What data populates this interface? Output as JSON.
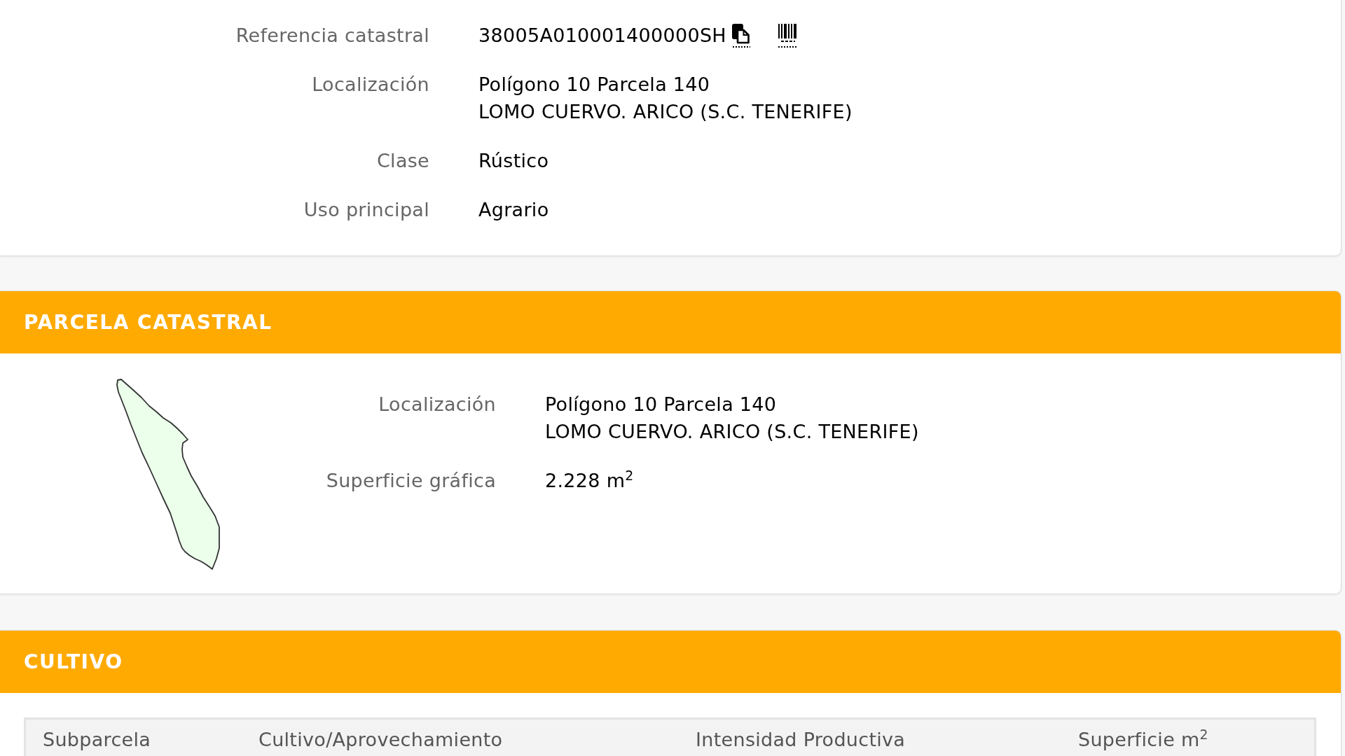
{
  "property_card": {
    "rows": [
      {
        "kind": "reference",
        "label": "Referencia catastral",
        "lines": [
          "38005A010001400000SH"
        ]
      },
      {
        "kind": "text",
        "label": "Localización",
        "lines": [
          "Polígono 10 Parcela 140",
          "LOMO CUERVO. ARICO (S.C. TENERIFE)"
        ]
      },
      {
        "kind": "text",
        "label": "Clase",
        "lines": [
          "Rústico"
        ]
      },
      {
        "kind": "text",
        "label": "Uso principal",
        "lines": [
          "Agrario"
        ]
      }
    ]
  },
  "parcel_card": {
    "title": "PARCELA CATASTRAL",
    "rows": [
      {
        "label": "Localización",
        "lines": [
          "Polígono 10 Parcela 140",
          "LOMO CUERVO. ARICO (S.C. TENERIFE)"
        ]
      },
      {
        "label": "Superficie gráfica",
        "lines": [
          "2.228 m$^{2}$"
        ]
      }
    ]
  },
  "crop_card": {
    "title": "CULTIVO",
    "table": {
      "columns": [
        "Subparcela",
        "Cultivo/Aprovechamiento",
        "Intensidad Productiva",
        "Superficie m$^{2}$"
      ]
    }
  }
}
